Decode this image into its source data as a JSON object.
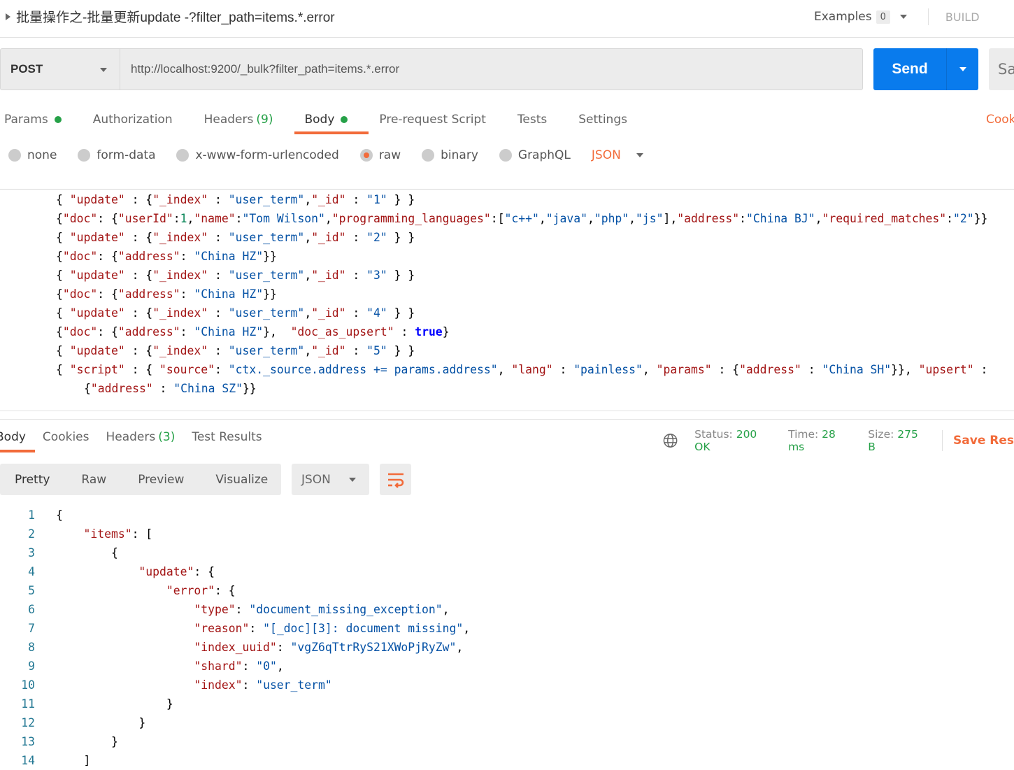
{
  "header": {
    "title": "批量操作之-批量更新update -?filter_path=items.*.error",
    "examples_label": "Examples",
    "examples_count": "0",
    "build_label": "BUILD"
  },
  "request": {
    "method": "POST",
    "url": "http://localhost:9200/_bulk?filter_path=items.*.error",
    "send_label": "Send",
    "save_label": "Sa"
  },
  "tabs": {
    "params": "Params",
    "authorization": "Authorization",
    "headers": "Headers",
    "headers_count": "(9)",
    "body": "Body",
    "prerequest": "Pre-request Script",
    "tests": "Tests",
    "settings": "Settings",
    "cookies": "Cook"
  },
  "body_types": {
    "none": "none",
    "form_data": "form-data",
    "urlencoded": "x-www-form-urlencoded",
    "raw": "raw",
    "binary": "binary",
    "graphql": "GraphQL",
    "format": "JSON",
    "selected": "raw"
  },
  "request_body": [
    [
      [
        "p",
        "{ "
      ],
      [
        "k",
        "\"update\""
      ],
      [
        "p",
        " : {"
      ],
      [
        "k",
        "\"_index\""
      ],
      [
        "p",
        " : "
      ],
      [
        "s",
        "\"user_term\""
      ],
      [
        "p",
        ","
      ],
      [
        "k",
        "\"_id\""
      ],
      [
        "p",
        " : "
      ],
      [
        "s",
        "\"1\""
      ],
      [
        "p",
        " } }"
      ]
    ],
    [
      [
        "p",
        "{"
      ],
      [
        "k",
        "\"doc\""
      ],
      [
        "p",
        ": {"
      ],
      [
        "k",
        "\"userId\""
      ],
      [
        "p",
        ":"
      ],
      [
        "n",
        "1"
      ],
      [
        "p",
        ","
      ],
      [
        "k",
        "\"name\""
      ],
      [
        "p",
        ":"
      ],
      [
        "s",
        "\"Tom Wilson\""
      ],
      [
        "p",
        ","
      ],
      [
        "k",
        "\"programming_languages\""
      ],
      [
        "p",
        ":["
      ],
      [
        "s",
        "\"c++\""
      ],
      [
        "p",
        ","
      ],
      [
        "s",
        "\"java\""
      ],
      [
        "p",
        ","
      ],
      [
        "s",
        "\"php\""
      ],
      [
        "p",
        ","
      ],
      [
        "s",
        "\"js\""
      ],
      [
        "p",
        "],"
      ],
      [
        "k",
        "\"address\""
      ],
      [
        "p",
        ":"
      ],
      [
        "s",
        "\"China BJ\""
      ],
      [
        "p",
        ","
      ],
      [
        "k",
        "\"required_matches\""
      ],
      [
        "p",
        ":"
      ],
      [
        "s",
        "\"2\""
      ],
      [
        "p",
        "}}"
      ]
    ],
    [
      [
        "p",
        "{ "
      ],
      [
        "k",
        "\"update\""
      ],
      [
        "p",
        " : {"
      ],
      [
        "k",
        "\"_index\""
      ],
      [
        "p",
        " : "
      ],
      [
        "s",
        "\"user_term\""
      ],
      [
        "p",
        ","
      ],
      [
        "k",
        "\"_id\""
      ],
      [
        "p",
        " : "
      ],
      [
        "s",
        "\"2\""
      ],
      [
        "p",
        " } }"
      ]
    ],
    [
      [
        "p",
        "{"
      ],
      [
        "k",
        "\"doc\""
      ],
      [
        "p",
        ": {"
      ],
      [
        "k",
        "\"address\""
      ],
      [
        "p",
        ": "
      ],
      [
        "s",
        "\"China HZ\""
      ],
      [
        "p",
        "}}"
      ]
    ],
    [
      [
        "p",
        "{ "
      ],
      [
        "k",
        "\"update\""
      ],
      [
        "p",
        " : {"
      ],
      [
        "k",
        "\"_index\""
      ],
      [
        "p",
        " : "
      ],
      [
        "s",
        "\"user_term\""
      ],
      [
        "p",
        ","
      ],
      [
        "k",
        "\"_id\""
      ],
      [
        "p",
        " : "
      ],
      [
        "s",
        "\"3\""
      ],
      [
        "p",
        " } }"
      ]
    ],
    [
      [
        "p",
        "{"
      ],
      [
        "k",
        "\"doc\""
      ],
      [
        "p",
        ": {"
      ],
      [
        "k",
        "\"address\""
      ],
      [
        "p",
        ": "
      ],
      [
        "s",
        "\"China HZ\""
      ],
      [
        "p",
        "}}"
      ]
    ],
    [
      [
        "p",
        "{ "
      ],
      [
        "k",
        "\"update\""
      ],
      [
        "p",
        " : {"
      ],
      [
        "k",
        "\"_index\""
      ],
      [
        "p",
        " : "
      ],
      [
        "s",
        "\"user_term\""
      ],
      [
        "p",
        ","
      ],
      [
        "k",
        "\"_id\""
      ],
      [
        "p",
        " : "
      ],
      [
        "s",
        "\"4\""
      ],
      [
        "p",
        " } }"
      ]
    ],
    [
      [
        "p",
        "{"
      ],
      [
        "k",
        "\"doc\""
      ],
      [
        "p",
        ": {"
      ],
      [
        "k",
        "\"address\""
      ],
      [
        "p",
        ": "
      ],
      [
        "s",
        "\"China HZ\""
      ],
      [
        "p",
        "},  "
      ],
      [
        "k",
        "\"doc_as_upsert\""
      ],
      [
        "p",
        " : "
      ],
      [
        "b",
        "true"
      ],
      [
        "p",
        "}"
      ]
    ],
    [
      [
        "p",
        "{ "
      ],
      [
        "k",
        "\"update\""
      ],
      [
        "p",
        " : {"
      ],
      [
        "k",
        "\"_index\""
      ],
      [
        "p",
        " : "
      ],
      [
        "s",
        "\"user_term\""
      ],
      [
        "p",
        ","
      ],
      [
        "k",
        "\"_id\""
      ],
      [
        "p",
        " : "
      ],
      [
        "s",
        "\"5\""
      ],
      [
        "p",
        " } }"
      ]
    ],
    [
      [
        "p",
        "{ "
      ],
      [
        "k",
        "\"script\""
      ],
      [
        "p",
        " : { "
      ],
      [
        "k",
        "\"source\""
      ],
      [
        "p",
        ": "
      ],
      [
        "s",
        "\"ctx._source.address += params.address\""
      ],
      [
        "p",
        ", "
      ],
      [
        "k",
        "\"lang\""
      ],
      [
        "p",
        " : "
      ],
      [
        "s",
        "\"painless\""
      ],
      [
        "p",
        ", "
      ],
      [
        "k",
        "\"params\""
      ],
      [
        "p",
        " : {"
      ],
      [
        "k",
        "\"address\""
      ],
      [
        "p",
        " : "
      ],
      [
        "s",
        "\"China SH\""
      ],
      [
        "p",
        "}}, "
      ],
      [
        "k",
        "\"upsert\""
      ],
      [
        "p",
        " : {"
      ],
      [
        "k",
        "\"address\""
      ],
      [
        "p",
        " : "
      ],
      [
        "s",
        "\"China SZ\""
      ],
      [
        "p",
        "}}"
      ]
    ],
    []
  ],
  "response": {
    "tabs": {
      "body": "Body",
      "cookies": "Cookies",
      "headers": "Headers",
      "headers_count": "(3)",
      "test_results": "Test Results"
    },
    "status_label": "Status:",
    "status": "200 OK",
    "time_label": "Time:",
    "time": "28 ms",
    "size_label": "Size:",
    "size": "275 B",
    "save_label": "Save Res",
    "views": {
      "pretty": "Pretty",
      "raw": "Raw",
      "preview": "Preview",
      "visualize": "Visualize",
      "format": "JSON"
    },
    "body": [
      [
        [
          "p",
          "{"
        ]
      ],
      [
        [
          "p",
          "    "
        ],
        [
          "k",
          "\"items\""
        ],
        [
          "p",
          ": ["
        ]
      ],
      [
        [
          "p",
          "        {"
        ]
      ],
      [
        [
          "p",
          "            "
        ],
        [
          "k",
          "\"update\""
        ],
        [
          "p",
          ": {"
        ]
      ],
      [
        [
          "p",
          "                "
        ],
        [
          "k",
          "\"error\""
        ],
        [
          "p",
          ": {"
        ]
      ],
      [
        [
          "p",
          "                    "
        ],
        [
          "k",
          "\"type\""
        ],
        [
          "p",
          ": "
        ],
        [
          "s",
          "\"document_missing_exception\""
        ],
        [
          "p",
          ","
        ]
      ],
      [
        [
          "p",
          "                    "
        ],
        [
          "k",
          "\"reason\""
        ],
        [
          "p",
          ": "
        ],
        [
          "s",
          "\"[_doc][3]: document missing\""
        ],
        [
          "p",
          ","
        ]
      ],
      [
        [
          "p",
          "                    "
        ],
        [
          "k",
          "\"index_uuid\""
        ],
        [
          "p",
          ": "
        ],
        [
          "s",
          "\"vgZ6qTtrRyS21XWoPjRyZw\""
        ],
        [
          "p",
          ","
        ]
      ],
      [
        [
          "p",
          "                    "
        ],
        [
          "k",
          "\"shard\""
        ],
        [
          "p",
          ": "
        ],
        [
          "s",
          "\"0\""
        ],
        [
          "p",
          ","
        ]
      ],
      [
        [
          "p",
          "                    "
        ],
        [
          "k",
          "\"index\""
        ],
        [
          "p",
          ": "
        ],
        [
          "s",
          "\"user_term\""
        ]
      ],
      [
        [
          "p",
          "                }"
        ]
      ],
      [
        [
          "p",
          "            }"
        ]
      ],
      [
        [
          "p",
          "        }"
        ]
      ],
      [
        [
          "p",
          "    ]"
        ]
      ]
    ]
  },
  "colors": {
    "accent": "#f26b3a",
    "send": "#097bed",
    "success": "#26a148"
  }
}
